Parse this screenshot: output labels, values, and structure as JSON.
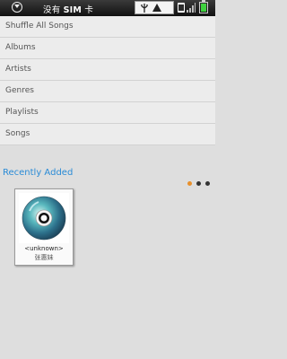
{
  "status_bar": {
    "carrier_prefix": "没有",
    "carrier_bold": "SIM",
    "carrier_suffix": "卡",
    "left_icon": "menu-down-icon",
    "notification_icons": [
      "usb-icon",
      "warning-icon"
    ],
    "right_icons": [
      "sim-icon",
      "signal-icon",
      "battery-icon"
    ],
    "battery_color": "#3fd13f"
  },
  "menu": {
    "items": [
      {
        "label": "Shuffle All Songs"
      },
      {
        "label": "Albums"
      },
      {
        "label": "Artists"
      },
      {
        "label": "Genres"
      },
      {
        "label": "Playlists"
      },
      {
        "label": "Songs"
      }
    ]
  },
  "recently_added": {
    "title": "Recently Added",
    "accent_color": "#2a8bd6",
    "page_count": 3,
    "active_page": 1,
    "albums": [
      {
        "name": "<unknown>",
        "artist": "张惠妹",
        "cover_icon": "cd-disc-icon"
      }
    ]
  }
}
